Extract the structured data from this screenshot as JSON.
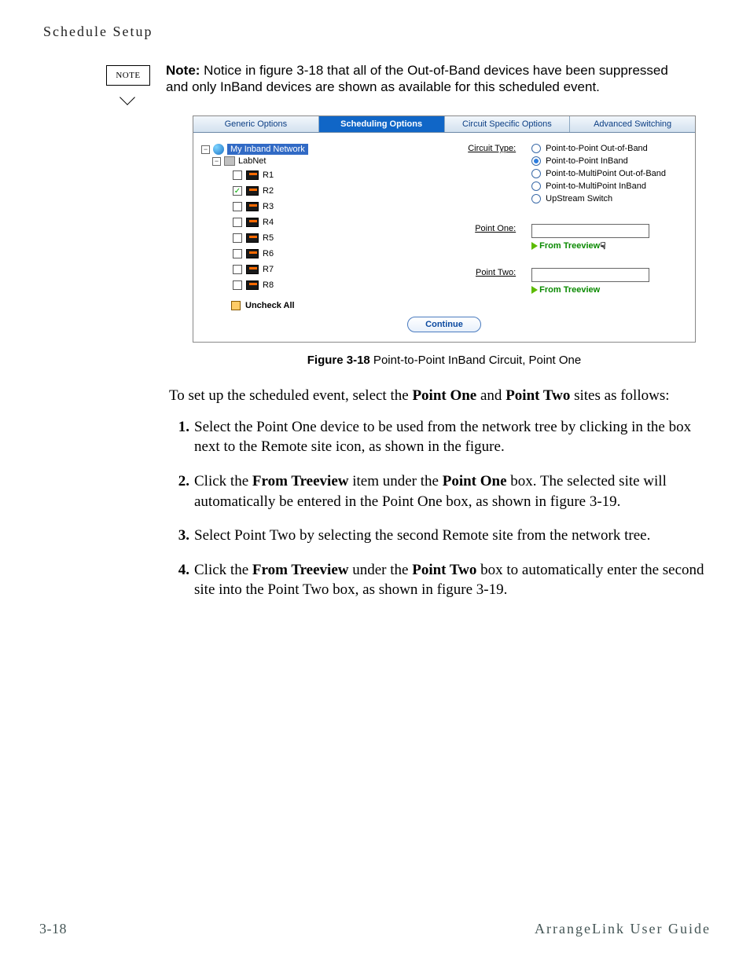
{
  "header": {
    "title": "Schedule Setup"
  },
  "note": {
    "badge_label": "NOTE",
    "prefix": "Note:",
    "body": "  Notice in figure 3-18 that all of the Out-of-Band devices have been suppressed and only InBand devices are shown as available for this scheduled event."
  },
  "figure": {
    "tabs": [
      "Generic Options",
      "Scheduling Options",
      "Circuit Specific Options",
      "Advanced Switching"
    ],
    "tree": {
      "root_label": "My Inband Network",
      "labnet_label": "LabNet",
      "nodes": [
        {
          "label": "R1",
          "checked": false
        },
        {
          "label": "R2",
          "checked": true
        },
        {
          "label": "R3",
          "checked": false
        },
        {
          "label": "R4",
          "checked": false
        },
        {
          "label": "R5",
          "checked": false
        },
        {
          "label": "R6",
          "checked": false
        },
        {
          "label": "R7",
          "checked": false
        },
        {
          "label": "R8",
          "checked": false
        }
      ]
    },
    "circuit_type_label": "Circuit Type:",
    "circuit_types": [
      "Point-to-Point Out-of-Band",
      "Point-to-Point InBand",
      "Point-to-MultiPoint Out-of-Band",
      "Point-to-MultiPoint InBand",
      "UpStream Switch"
    ],
    "selected_circuit_type_index": 1,
    "point_one_label": "Point One:",
    "point_two_label": "Point Two:",
    "from_treeview_label": "From Treeview",
    "uncheck_all_label": "Uncheck All",
    "continue_label": "Continue"
  },
  "caption": {
    "fig": "Figure 3-18",
    "text": "   Point-to-Point InBand Circuit, Point One"
  },
  "intro": {
    "pre": "To set up the scheduled event, select the ",
    "b1": "Point One",
    "mid": " and ",
    "b2": "Point Two",
    "post": " sites as follows:"
  },
  "steps": [
    {
      "n": "1.",
      "parts": [
        {
          "t": "Select the Point One device to be used from the network tree by clicking in the box next to the Remote site icon, as shown in the figure."
        }
      ]
    },
    {
      "n": "2.",
      "parts": [
        {
          "t": "Click the "
        },
        {
          "b": "From Treeview"
        },
        {
          "t": " item under the "
        },
        {
          "b": "Point One"
        },
        {
          "t": " box. The selected site will automatically be entered in the Point One box, as shown in figure 3-19."
        }
      ]
    },
    {
      "n": "3.",
      "parts": [
        {
          "t": "Select Point Two by selecting the second Remote site from the network tree."
        }
      ]
    },
    {
      "n": "4.",
      "parts": [
        {
          "t": "Click the "
        },
        {
          "b": "From Treeview"
        },
        {
          "t": " under the "
        },
        {
          "b": "Point Two"
        },
        {
          "t": " box to automatically enter the second site into the Point Two box, as shown in figure 3-19."
        }
      ]
    }
  ],
  "footer": {
    "page": "3-18",
    "guide": "ArrangeLink User Guide"
  }
}
